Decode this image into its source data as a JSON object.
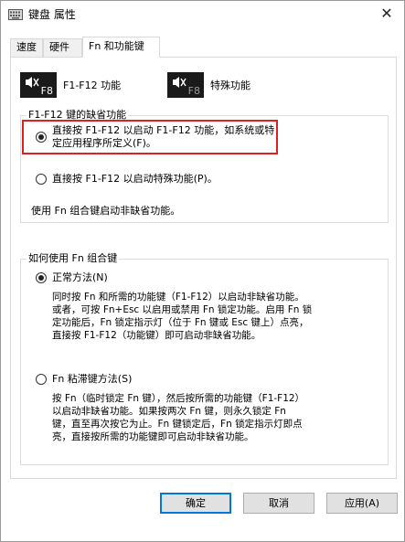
{
  "window": {
    "title": "键盘 属性",
    "close_glyph": "✕"
  },
  "tabs": [
    {
      "label": "速度",
      "selected": false
    },
    {
      "label": "硬件",
      "selected": false
    },
    {
      "label": "Fn 和功能键",
      "selected": true
    }
  ],
  "keys": {
    "f1f12": {
      "key_label": "F8",
      "text": "F1-F12 功能",
      "icon": "mute-speaker-icon"
    },
    "special": {
      "key_label": "F8",
      "text": "特殊功能",
      "icon": "mute-speaker-icon"
    }
  },
  "default_group": {
    "legend": "F1-F12 键的缺省功能",
    "option1_line1": "直接按 F1-F12 以启动 F1-F12 功能，如系统或特",
    "option1_line2": "定应用程序所定义(F)。",
    "option1_checked": true,
    "option2": "直接按 F1-F12 以启动特殊功能(P)。",
    "option2_checked": false,
    "note": "使用 Fn 组合键启动非缺省功能。"
  },
  "fn_group": {
    "legend": "如何使用 Fn 组合键",
    "normal_label": "正常方法(N)",
    "normal_checked": true,
    "normal_desc": "同时按 Fn 和所需的功能键（F1-F12）以启动非缺省功能。\n或者，可按 Fn+Esc 以启用或禁用 Fn 锁定功能。启用 Fn 锁\n定功能后，Fn 锁定指示灯（位于 Fn 键或 Esc 键上）点亮，\n直接按 F1-F12（功能键）即可启动非缺省功能。",
    "sticky_label": "Fn 粘滞键方法(S)",
    "sticky_checked": false,
    "sticky_desc": "按 Fn（临时锁定 Fn 键），然后按所需的功能键（F1-F12）\n以启动非缺省功能。如果按两次 Fn 键，则永久锁定 Fn\n键，直至再次按它为止。Fn 键锁定后，Fn 锁定指示灯即点\n亮，直接按所需的功能键即可启动非缺省功能。"
  },
  "buttons": {
    "ok": "确定",
    "cancel": "取消",
    "apply": "应用(A)"
  },
  "colors": {
    "highlight": "#e02020",
    "default_button_border": "#0078d7"
  }
}
